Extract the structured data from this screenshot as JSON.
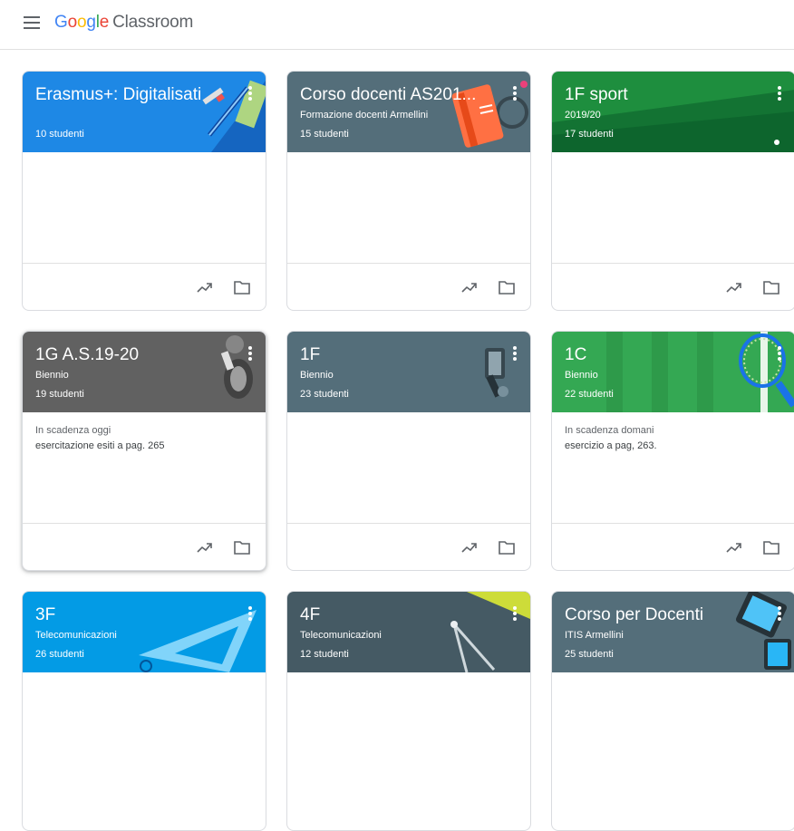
{
  "header": {
    "logo_letters": [
      "G",
      "o",
      "o",
      "g",
      "l",
      "e"
    ],
    "product": "Classroom"
  },
  "cards": [
    {
      "title": "Erasmus+: Digitalisati",
      "section": "",
      "students": "10 studenti",
      "color": "#1e88e5"
    },
    {
      "title": "Corso docenti AS201...",
      "section": "Formazione docenti Armellini",
      "students": "15 studenti",
      "color": "#546e7a"
    },
    {
      "title": "1F sport",
      "section": "2019/20",
      "students": "17 studenti",
      "color": "#1e8e3e"
    },
    {
      "title": "1G A.S.19-20",
      "section": "Biennio",
      "students": "19 studenti",
      "color": "#616161",
      "due_label": "In scadenza oggi",
      "due_text": "esercitazione esiti a pag. 265"
    },
    {
      "title": "1F",
      "section": "Biennio",
      "students": "23 studenti",
      "color": "#546e7a"
    },
    {
      "title": "1C",
      "section": "Biennio",
      "students": "22 studenti",
      "color": "#34a853",
      "due_label": "In scadenza domani",
      "due_text": "esercizio a pag, 263."
    },
    {
      "title": "3F",
      "section": "Telecomunicazioni",
      "students": "26 studenti",
      "color": "#039be5"
    },
    {
      "title": "4F",
      "section": "Telecomunicazioni",
      "students": "12 studenti",
      "color": "#455a64"
    },
    {
      "title": "Corso per Docenti",
      "section": "ITIS Armellini",
      "students": "25 studenti",
      "color": "#546e7a"
    }
  ]
}
